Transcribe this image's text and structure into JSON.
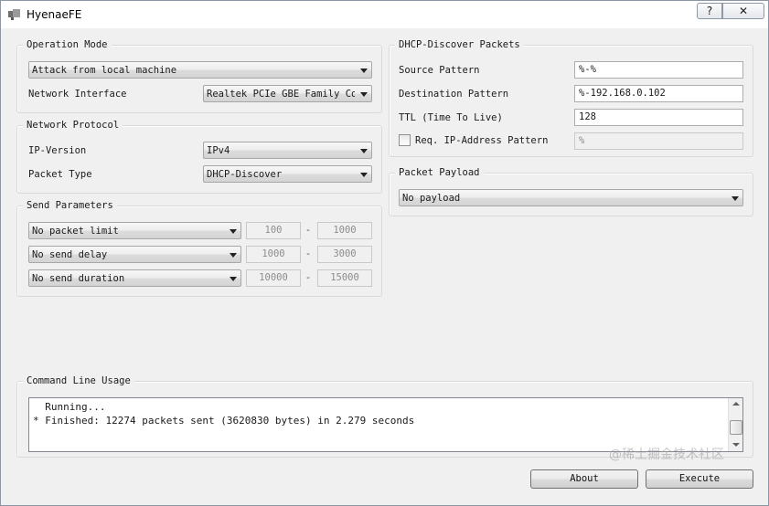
{
  "window": {
    "title": "HyenaeFE",
    "help_label": "?",
    "close_label": "✕",
    "icon": "app-icon"
  },
  "operation_mode": {
    "title": "Operation Mode",
    "mode_value": "Attack from local machine",
    "interface_label": "Network Interface",
    "interface_value": "Realtek PCIe GBE Family Con"
  },
  "network_protocol": {
    "title": "Network Protocol",
    "ip_version_label": "IP-Version",
    "ip_version_value": "IPv4",
    "packet_type_label": "Packet Type",
    "packet_type_value": "DHCP-Discover"
  },
  "send_parameters": {
    "title": "Send Parameters",
    "rows": [
      {
        "mode": "No packet limit",
        "min": "100",
        "max": "1000"
      },
      {
        "mode": "No send delay",
        "min": "1000",
        "max": "3000"
      },
      {
        "mode": "No send duration",
        "min": "10000",
        "max": "15000"
      }
    ],
    "separator": "-"
  },
  "dhcp_discover": {
    "title": "DHCP-Discover Packets",
    "source_label": "Source Pattern",
    "source_value": "%-%",
    "destination_label": "Destination Pattern",
    "destination_value": "%-192.168.0.102",
    "ttl_label": "TTL (Time To Live)",
    "ttl_value": "128",
    "req_ip_label": "Req. IP-Address Pattern",
    "req_ip_value": "%",
    "req_ip_checked": false
  },
  "packet_payload": {
    "title": "Packet Payload",
    "value": "No payload"
  },
  "command_line": {
    "title": "Command Line Usage",
    "output": "  Running...\n* Finished: 12274 packets sent (3620830 bytes) in 2.279 seconds"
  },
  "buttons": {
    "about": "About",
    "execute": "Execute"
  },
  "watermark": "@稀土掘金技术社区"
}
